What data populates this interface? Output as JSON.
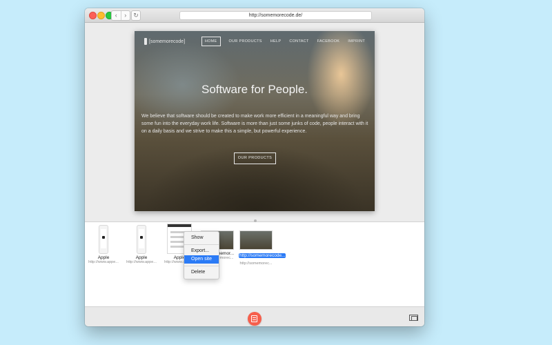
{
  "browser": {
    "url": "http://somemorecode.de/",
    "back_glyph": "‹",
    "forward_glyph": "›",
    "reload_glyph": "↻"
  },
  "site": {
    "logo_text": "[somemorecode]",
    "nav": [
      "HOME",
      "OUR PRODUCTS",
      "HELP",
      "CONTACT",
      "FACEBOOK",
      "IMPRINT"
    ],
    "hero_title": "Software for People.",
    "hero_text": "We believe that software should be created to make work more efficient in a meaningful way and bring some fun into the everyday work life. Software is more than just some junks of code, people interact with it on a daily basis and we strive to make this a simple, but powerful experience.",
    "hero_button": "OUR PRODUCTS"
  },
  "library": {
    "items": [
      {
        "title": "Apple",
        "subtitle": "http://www.appe..."
      },
      {
        "title": "Apple",
        "subtitle": "http://www.appe..."
      },
      {
        "title": "Apple",
        "subtitle": "http://www.appe..."
      },
      {
        "title": "http://somemor...",
        "subtitle": "http://somemorec..."
      },
      {
        "title": "http://somemorecode...",
        "subtitle": "http://somemorec..."
      }
    ]
  },
  "context_menu": {
    "items": [
      "Show",
      "Export...",
      "Open site",
      "Delete"
    ]
  },
  "colors": {
    "accent": "#2b7bf6",
    "capture_button": "#f65f4c",
    "desktop": "#c6ecfb"
  },
  "icons": {
    "capture": "calendar-icon",
    "fullscreen": "fullscreen-icon"
  }
}
